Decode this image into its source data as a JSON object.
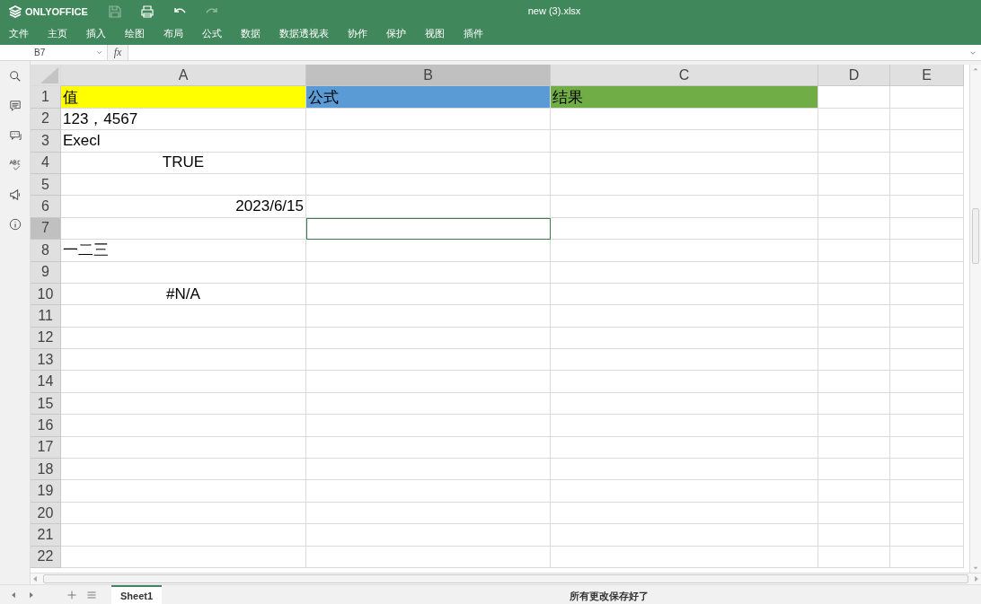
{
  "app": {
    "logo": "ONLYOFFICE",
    "title": "new (3).xlsx"
  },
  "toolbar": [
    {
      "kind": "save",
      "disabled": true
    },
    {
      "kind": "print",
      "disabled": false
    },
    {
      "kind": "undo",
      "disabled": false
    },
    {
      "kind": "redo",
      "disabled": true
    }
  ],
  "menu": [
    "文件",
    "主页",
    "插入",
    "绘图",
    "布局",
    "公式",
    "数据",
    "数据透视表",
    "协作",
    "保护",
    "视图",
    "插件"
  ],
  "formula_bar": {
    "cell_name": "B7",
    "fx": "fx"
  },
  "sidebar": [
    {
      "kind": "search"
    },
    {
      "kind": "comment"
    },
    {
      "kind": "chat"
    },
    {
      "kind": "spellcheck"
    },
    {
      "kind": "feedback"
    },
    {
      "kind": "about"
    }
  ],
  "columns": [
    {
      "label": "A",
      "selected": false
    },
    {
      "label": "B",
      "selected": true
    },
    {
      "label": "C",
      "selected": false
    },
    {
      "label": "D",
      "selected": false
    },
    {
      "label": "E",
      "selected": false
    }
  ],
  "rows": [
    {
      "number": "1",
      "selected": false,
      "cells": [
        {
          "text": "值",
          "kind": "text",
          "color": "#ffff00"
        },
        {
          "text": "公式",
          "kind": "text",
          "color": "#5b9bd5"
        },
        {
          "text": "结果",
          "kind": "text",
          "color": "#70ad47"
        },
        {},
        {}
      ]
    },
    {
      "number": "2",
      "selected": false,
      "cells": [
        {
          "text": "123，4567",
          "kind": "text"
        },
        {},
        {},
        {},
        {}
      ]
    },
    {
      "number": "3",
      "selected": false,
      "cells": [
        {
          "text": "Execl",
          "kind": "text"
        },
        {},
        {},
        {},
        {}
      ]
    },
    {
      "number": "4",
      "selected": false,
      "cells": [
        {
          "text": "TRUE",
          "kind": "boolean"
        },
        {},
        {},
        {},
        {}
      ]
    },
    {
      "number": "5",
      "selected": false,
      "cells": [
        {},
        {},
        {},
        {},
        {}
      ]
    },
    {
      "number": "6",
      "selected": false,
      "cells": [
        {
          "text": "2023/6/15",
          "kind": "date"
        },
        {},
        {},
        {},
        {}
      ]
    },
    {
      "number": "7",
      "selected": true,
      "cells": [
        {},
        {},
        {},
        {},
        {}
      ]
    },
    {
      "number": "8",
      "selected": false,
      "cells": [
        {
          "text": "一二三",
          "kind": "text"
        },
        {},
        {},
        {},
        {}
      ]
    },
    {
      "number": "9",
      "selected": false,
      "cells": [
        {},
        {},
        {},
        {},
        {}
      ]
    },
    {
      "number": "10",
      "selected": false,
      "cells": [
        {
          "text": "#N/A",
          "kind": "error"
        },
        {},
        {},
        {},
        {}
      ]
    },
    {
      "number": "11",
      "selected": false,
      "cells": [
        {},
        {},
        {},
        {},
        {}
      ]
    },
    {
      "number": "12",
      "selected": false,
      "cells": [
        {},
        {},
        {},
        {},
        {}
      ]
    },
    {
      "number": "13",
      "selected": false,
      "cells": [
        {},
        {},
        {},
        {},
        {}
      ]
    },
    {
      "number": "14",
      "selected": false,
      "cells": [
        {},
        {},
        {},
        {},
        {}
      ]
    },
    {
      "number": "15",
      "selected": false,
      "cells": [
        {},
        {},
        {},
        {},
        {}
      ]
    },
    {
      "number": "16",
      "selected": false,
      "cells": [
        {},
        {},
        {},
        {},
        {}
      ]
    },
    {
      "number": "17",
      "selected": false,
      "cells": [
        {},
        {},
        {},
        {},
        {}
      ]
    },
    {
      "number": "18",
      "selected": false,
      "cells": [
        {},
        {},
        {},
        {},
        {}
      ]
    },
    {
      "number": "19",
      "selected": false,
      "cells": [
        {},
        {},
        {},
        {},
        {}
      ]
    },
    {
      "number": "20",
      "selected": false,
      "cells": [
        {},
        {},
        {},
        {},
        {}
      ]
    },
    {
      "number": "21",
      "selected": false,
      "cells": [
        {},
        {},
        {},
        {},
        {}
      ]
    },
    {
      "number": "22",
      "selected": false,
      "cells": [
        {},
        {},
        {},
        {},
        {}
      ]
    }
  ],
  "sheet_tabs": [
    {
      "label": "Sheet1",
      "selected": true
    }
  ],
  "status": "所有更改保存好了"
}
